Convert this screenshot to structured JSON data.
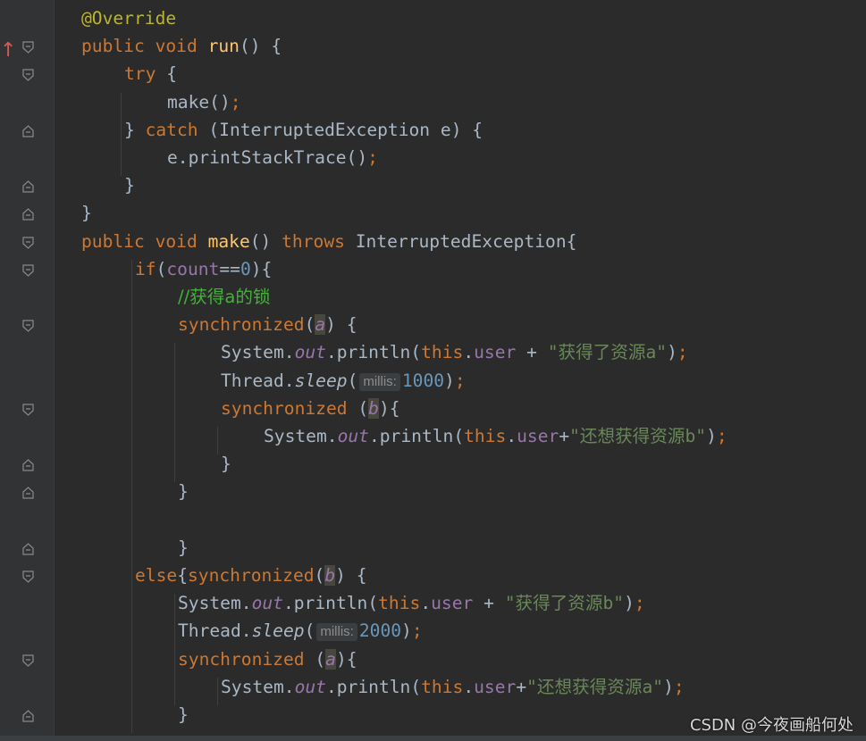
{
  "editor": {
    "lines": [
      [
        {
          "c": "ann",
          "t": "@Override"
        }
      ],
      [
        {
          "c": "kw",
          "t": "public void "
        },
        {
          "c": "fn",
          "t": "run"
        },
        {
          "c": "",
          "t": "() {"
        }
      ],
      [
        {
          "c": "kw",
          "t": "try "
        },
        {
          "c": "",
          "t": "{"
        }
      ],
      [
        {
          "c": "",
          "t": "make()"
        },
        {
          "c": "semi",
          "t": ";"
        }
      ],
      [
        {
          "c": "",
          "t": "} "
        },
        {
          "c": "kw",
          "t": "catch "
        },
        {
          "c": "",
          "t": "(InterruptedException e) {"
        }
      ],
      [
        {
          "c": "",
          "t": "e.printStackTrace()"
        },
        {
          "c": "semi",
          "t": ";"
        }
      ],
      [
        {
          "c": "",
          "t": "}"
        }
      ],
      [
        {
          "c": "",
          "t": "}"
        }
      ],
      [
        {
          "c": "kw",
          "t": "public void "
        },
        {
          "c": "fn",
          "t": "make"
        },
        {
          "c": "",
          "t": "() "
        },
        {
          "c": "kw",
          "t": "throws "
        },
        {
          "c": "",
          "t": "InterruptedException{"
        }
      ],
      [
        {
          "c": "kw",
          "t": "if"
        },
        {
          "c": "",
          "t": "("
        },
        {
          "c": "fld",
          "t": "count"
        },
        {
          "c": "",
          "t": "=="
        },
        {
          "c": "num",
          "t": "0"
        },
        {
          "c": "",
          "t": "){"
        }
      ],
      [
        {
          "c": "cm",
          "t": "//获得a的锁"
        }
      ],
      [
        {
          "c": "kw",
          "t": "synchronized"
        },
        {
          "c": "",
          "t": "("
        },
        {
          "c": "fld it hl",
          "t": "a"
        },
        {
          "c": "",
          "t": ") {"
        }
      ],
      [
        {
          "c": "",
          "t": "System."
        },
        {
          "c": "fld it",
          "t": "out"
        },
        {
          "c": "",
          "t": ".println("
        },
        {
          "c": "kw",
          "t": "this"
        },
        {
          "c": "",
          "t": "."
        },
        {
          "c": "fld",
          "t": "user"
        },
        {
          "c": "",
          "t": " + "
        },
        {
          "c": "str",
          "t": "\"获得了资源a\""
        },
        {
          "c": "",
          "t": ")"
        },
        {
          "c": "semi",
          "t": ";"
        }
      ],
      [
        {
          "c": "",
          "t": "Thread."
        },
        {
          "c": "it",
          "t": "sleep"
        },
        {
          "c": "",
          "t": "("
        },
        {
          "c": "hint",
          "t": "millis:"
        },
        {
          "c": "num",
          "t": "1000"
        },
        {
          "c": "",
          "t": ")"
        },
        {
          "c": "semi",
          "t": ";"
        }
      ],
      [
        {
          "c": "kw",
          "t": "synchronized "
        },
        {
          "c": "",
          "t": "("
        },
        {
          "c": "fld it hl",
          "t": "b"
        },
        {
          "c": "",
          "t": "){"
        }
      ],
      [
        {
          "c": "",
          "t": "System."
        },
        {
          "c": "fld it",
          "t": "out"
        },
        {
          "c": "",
          "t": ".println("
        },
        {
          "c": "kw",
          "t": "this"
        },
        {
          "c": "",
          "t": "."
        },
        {
          "c": "fld",
          "t": "user"
        },
        {
          "c": "",
          "t": "+"
        },
        {
          "c": "str",
          "t": "\"还想获得资源b\""
        },
        {
          "c": "",
          "t": ")"
        },
        {
          "c": "semi",
          "t": ";"
        }
      ],
      [
        {
          "c": "",
          "t": "}"
        }
      ],
      [
        {
          "c": "",
          "t": "}"
        }
      ],
      [],
      [
        {
          "c": "",
          "t": "}"
        }
      ],
      [
        {
          "c": "kw",
          "t": "else"
        },
        {
          "c": "",
          "t": "{"
        },
        {
          "c": "kw",
          "t": "synchronized"
        },
        {
          "c": "",
          "t": "("
        },
        {
          "c": "fld it hl",
          "t": "b"
        },
        {
          "c": "",
          "t": ") {"
        }
      ],
      [
        {
          "c": "",
          "t": "System."
        },
        {
          "c": "fld it",
          "t": "out"
        },
        {
          "c": "",
          "t": ".println("
        },
        {
          "c": "kw",
          "t": "this"
        },
        {
          "c": "",
          "t": "."
        },
        {
          "c": "fld",
          "t": "user"
        },
        {
          "c": "",
          "t": " + "
        },
        {
          "c": "str",
          "t": "\"获得了资源b\""
        },
        {
          "c": "",
          "t": ")"
        },
        {
          "c": "semi",
          "t": ";"
        }
      ],
      [
        {
          "c": "",
          "t": "Thread."
        },
        {
          "c": "it",
          "t": "sleep"
        },
        {
          "c": "",
          "t": "("
        },
        {
          "c": "hint",
          "t": "millis:"
        },
        {
          "c": "num",
          "t": "2000"
        },
        {
          "c": "",
          "t": ")"
        },
        {
          "c": "semi",
          "t": ";"
        }
      ],
      [
        {
          "c": "kw",
          "t": "synchronized "
        },
        {
          "c": "",
          "t": "("
        },
        {
          "c": "fld it hl",
          "t": "a"
        },
        {
          "c": "",
          "t": "){"
        }
      ],
      [
        {
          "c": "",
          "t": "System."
        },
        {
          "c": "fld it",
          "t": "out"
        },
        {
          "c": "",
          "t": ".println("
        },
        {
          "c": "kw",
          "t": "this"
        },
        {
          "c": "",
          "t": "."
        },
        {
          "c": "fld",
          "t": "user"
        },
        {
          "c": "",
          "t": "+"
        },
        {
          "c": "str",
          "t": "\"还想获得资源a\""
        },
        {
          "c": "",
          "t": ")"
        },
        {
          "c": "semi",
          "t": ";"
        }
      ],
      [
        {
          "c": "",
          "t": "}"
        }
      ]
    ]
  },
  "gutter": {
    "override_marker_icon": "override-method-arrow-icon",
    "fold_icon": "fold-marker-icon"
  },
  "watermark": "CSDN @今夜画船何处",
  "colors": {
    "background": "#2b2b2b",
    "gutter": "#313335",
    "keyword": "#cc7832",
    "method": "#ffc66d",
    "annotation": "#bbb529",
    "field": "#9876aa",
    "number": "#6897bb",
    "string": "#6a8759",
    "comment": "#45b03b",
    "default": "#a9b7c6"
  }
}
